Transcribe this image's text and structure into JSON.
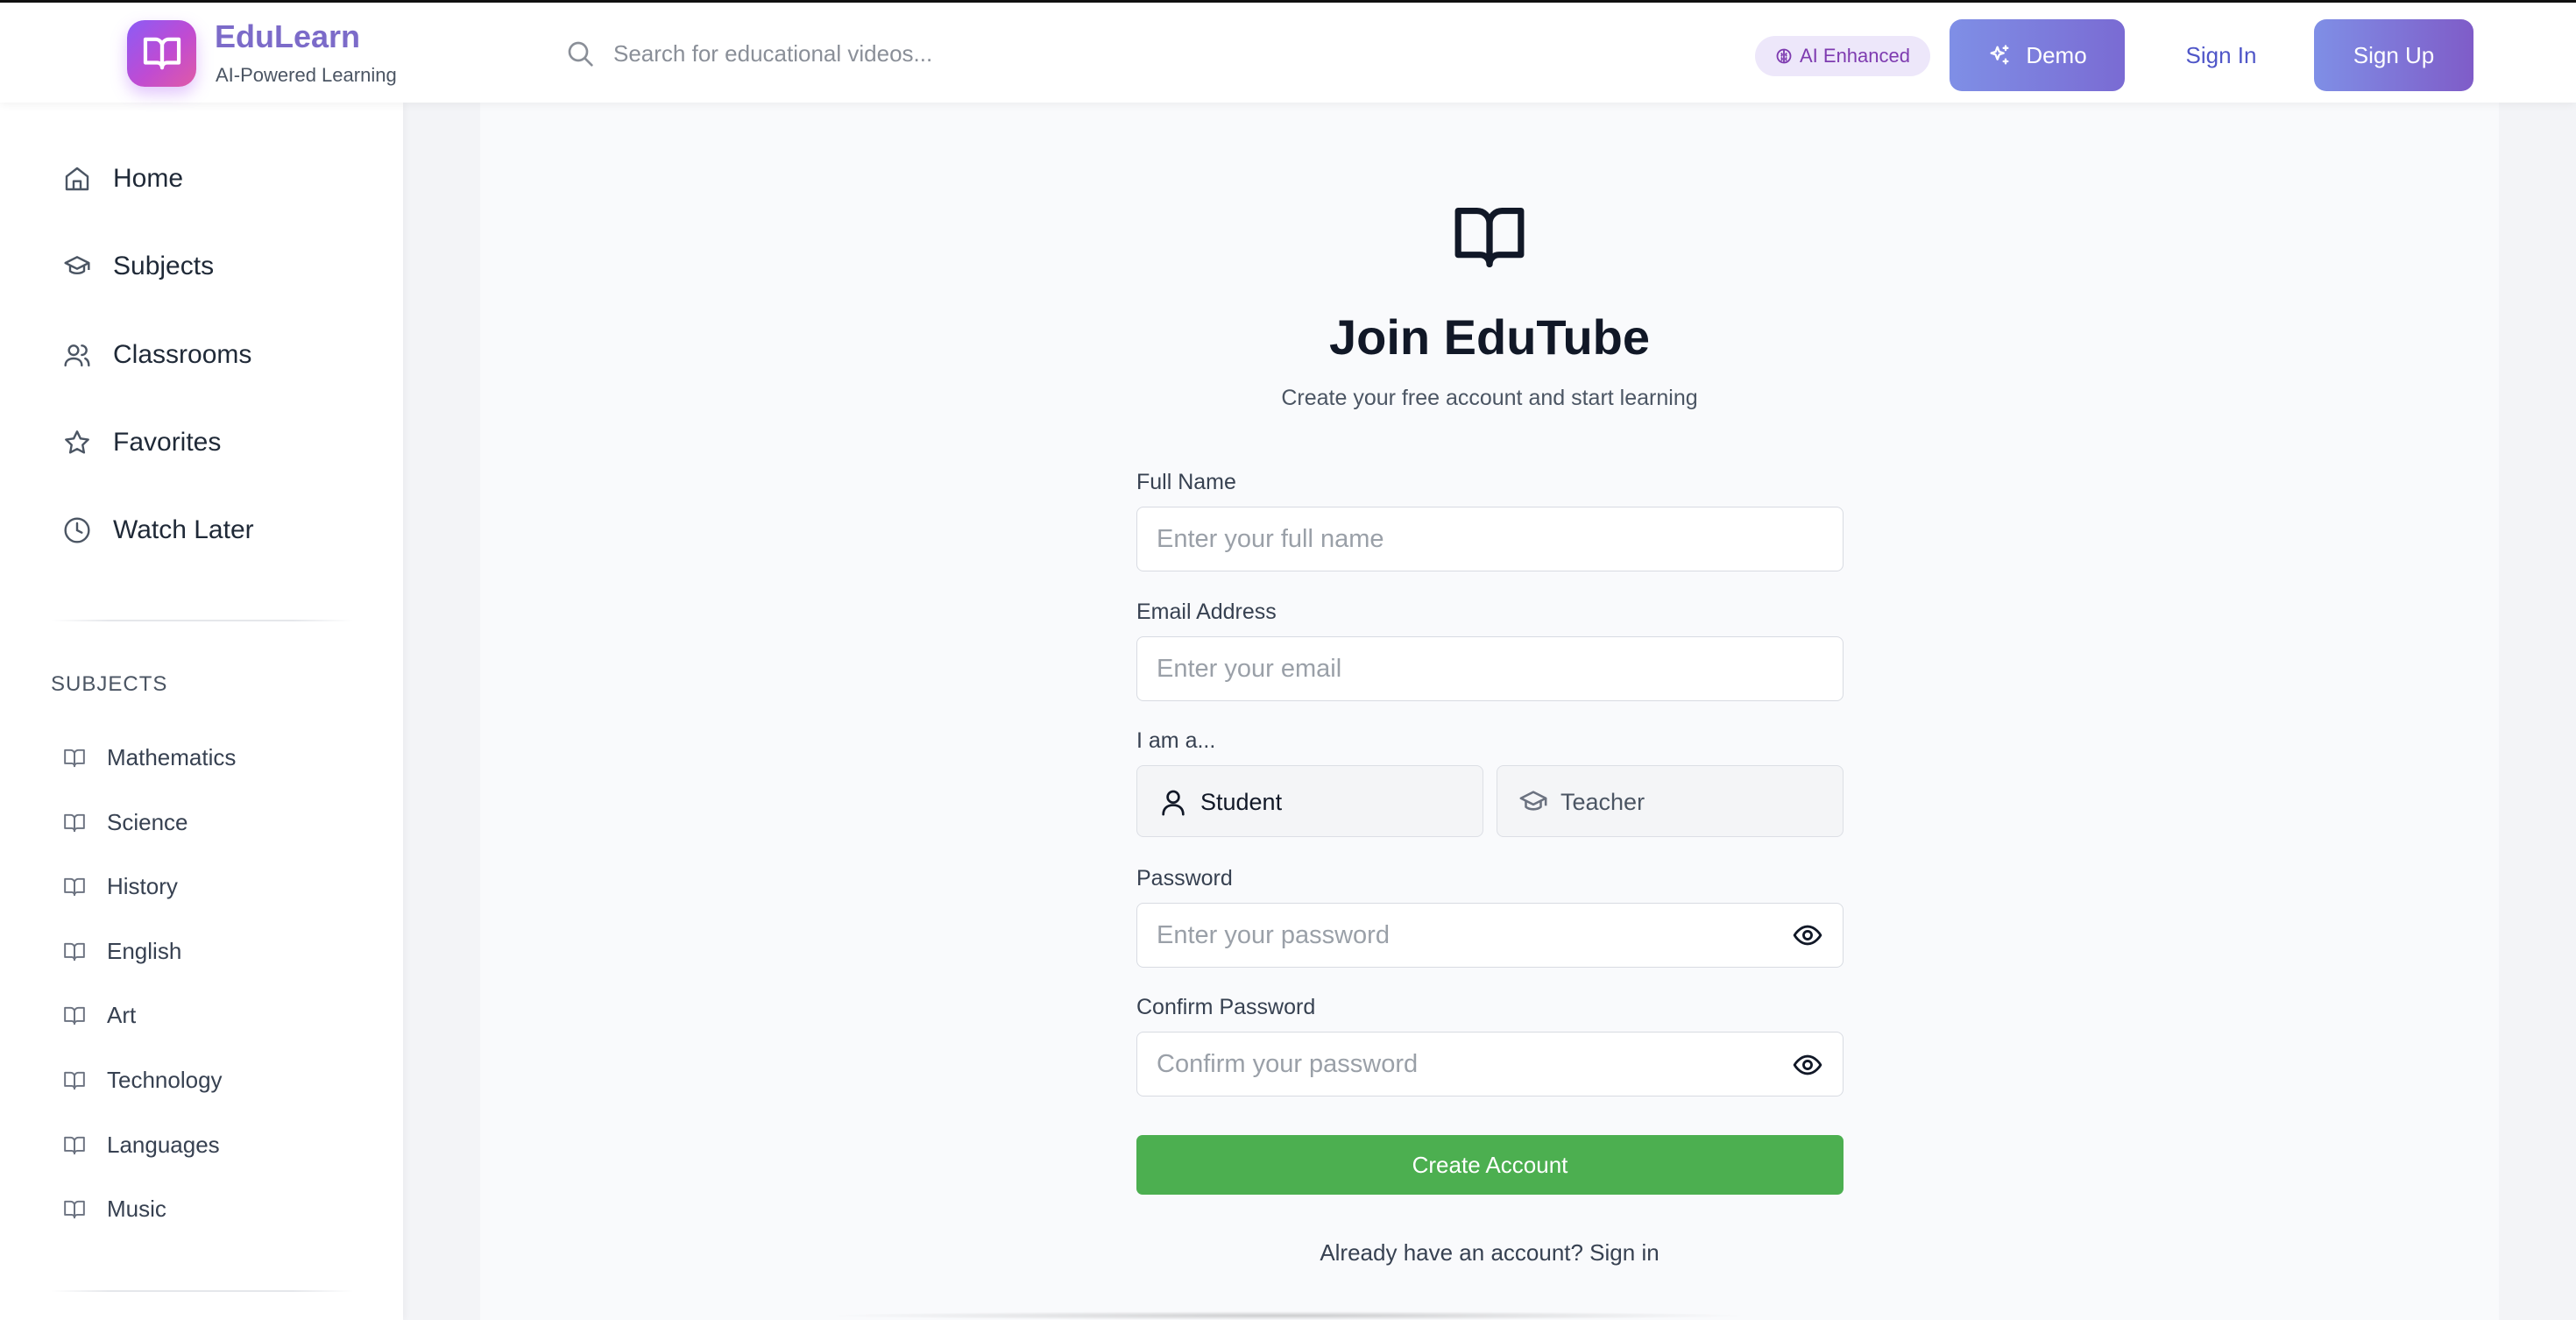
{
  "brand": {
    "name": "EduLearn",
    "tagline": "AI-Powered Learning",
    "logo_icon": "book-open-icon",
    "accent_gradient": [
      "#8b5cf6",
      "#e05aa6"
    ]
  },
  "header": {
    "search_placeholder": "Search for educational videos...",
    "ai_badge": "AI Enhanced",
    "demo_label": "Demo",
    "sign_in_label": "Sign In",
    "sign_up_label": "Sign Up"
  },
  "sidebar": {
    "nav": [
      {
        "label": "Home",
        "icon": "home-icon"
      },
      {
        "label": "Subjects",
        "icon": "graduation-cap-icon"
      },
      {
        "label": "Classrooms",
        "icon": "users-icon"
      },
      {
        "label": "Favorites",
        "icon": "star-icon"
      },
      {
        "label": "Watch Later",
        "icon": "clock-icon"
      }
    ],
    "subjects_title": "SUBJECTS",
    "subjects": [
      {
        "label": "Mathematics",
        "icon": "book-icon"
      },
      {
        "label": "Science",
        "icon": "book-icon"
      },
      {
        "label": "History",
        "icon": "book-icon"
      },
      {
        "label": "English",
        "icon": "book-icon"
      },
      {
        "label": "Art",
        "icon": "book-icon"
      },
      {
        "label": "Technology",
        "icon": "book-icon"
      },
      {
        "label": "Languages",
        "icon": "book-icon"
      },
      {
        "label": "Music",
        "icon": "book-icon"
      }
    ]
  },
  "form": {
    "title": "Join EduTube",
    "subtitle": "Create your free account and start learning",
    "full_name_label": "Full Name",
    "full_name_placeholder": "Enter your full name",
    "email_label": "Email Address",
    "email_placeholder": "Enter your email",
    "role_label": "I am a...",
    "roles": [
      {
        "label": "Student",
        "icon": "user-icon",
        "selected": true
      },
      {
        "label": "Teacher",
        "icon": "graduation-cap-icon",
        "selected": false
      }
    ],
    "password_label": "Password",
    "password_placeholder": "Enter your password",
    "confirm_label": "Confirm Password",
    "confirm_placeholder": "Confirm your password",
    "submit_label": "Create Account",
    "submit_color": "#4caf50",
    "signin_prompt": "Already have an account? Sign in"
  }
}
